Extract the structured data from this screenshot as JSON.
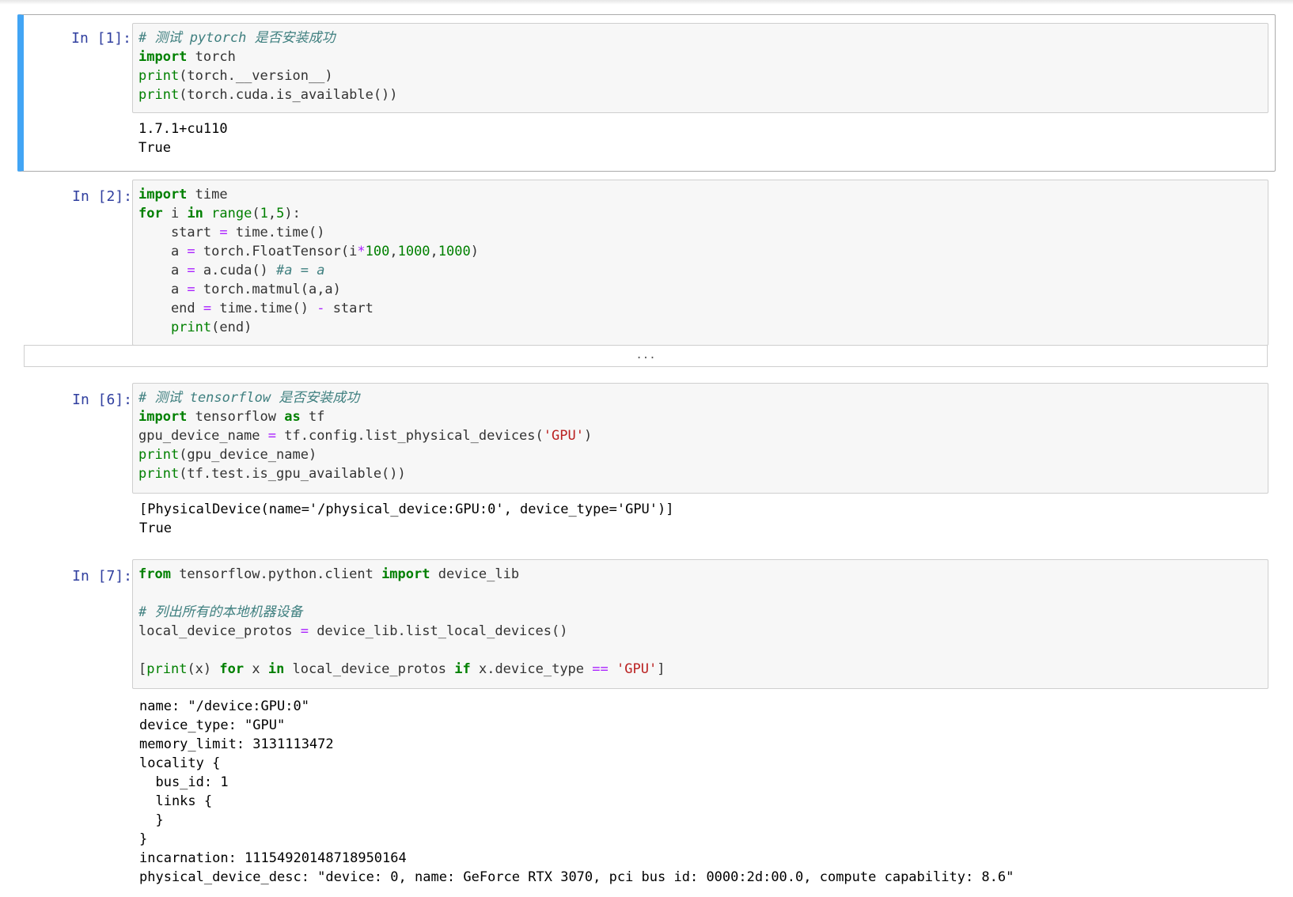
{
  "cells": [
    {
      "prompt": "In [1]:",
      "code": [
        "# 测试 pytorch 是否安装成功",
        "import torch",
        "print(torch.__version__)",
        "print(torch.cuda.is_available())"
      ],
      "output": [
        "1.7.1+cu110",
        "True"
      ]
    },
    {
      "prompt": "In [2]:",
      "code": [
        "import time",
        "for i in range(1,5):",
        "    start = time.time()",
        "    a = torch.FloatTensor(i*100,1000,1000)",
        "    a = a.cuda() #a = a",
        "    a = torch.matmul(a,a)",
        "    end = time.time() - start",
        "    print(end)"
      ],
      "collapsed_output": "..."
    },
    {
      "prompt": "In [6]:",
      "code": [
        "# 测试 tensorflow 是否安装成功",
        "import tensorflow as tf",
        "gpu_device_name = tf.config.list_physical_devices('GPU')",
        "print(gpu_device_name)",
        "print(tf.test.is_gpu_available())"
      ],
      "output": [
        "[PhysicalDevice(name='/physical_device:GPU:0', device_type='GPU')]",
        "True"
      ]
    },
    {
      "prompt": "In [7]:",
      "code": [
        "from tensorflow.python.client import device_lib",
        "",
        "# 列出所有的本地机器设备",
        "local_device_protos = device_lib.list_local_devices()",
        "",
        "[print(x) for x in local_device_protos if x.device_type == 'GPU']"
      ],
      "output": [
        "name: \"/device:GPU:0\"",
        "device_type: \"GPU\"",
        "memory_limit: 3131113472",
        "locality {",
        "  bus_id: 1",
        "  links {",
        "  }",
        "}",
        "incarnation: 11154920148718950164",
        "physical_device_desc: \"device: 0, name: GeForce RTX 3070, pci bus id: 0000:2d:00.0, compute capability: 8.6\""
      ]
    }
  ]
}
